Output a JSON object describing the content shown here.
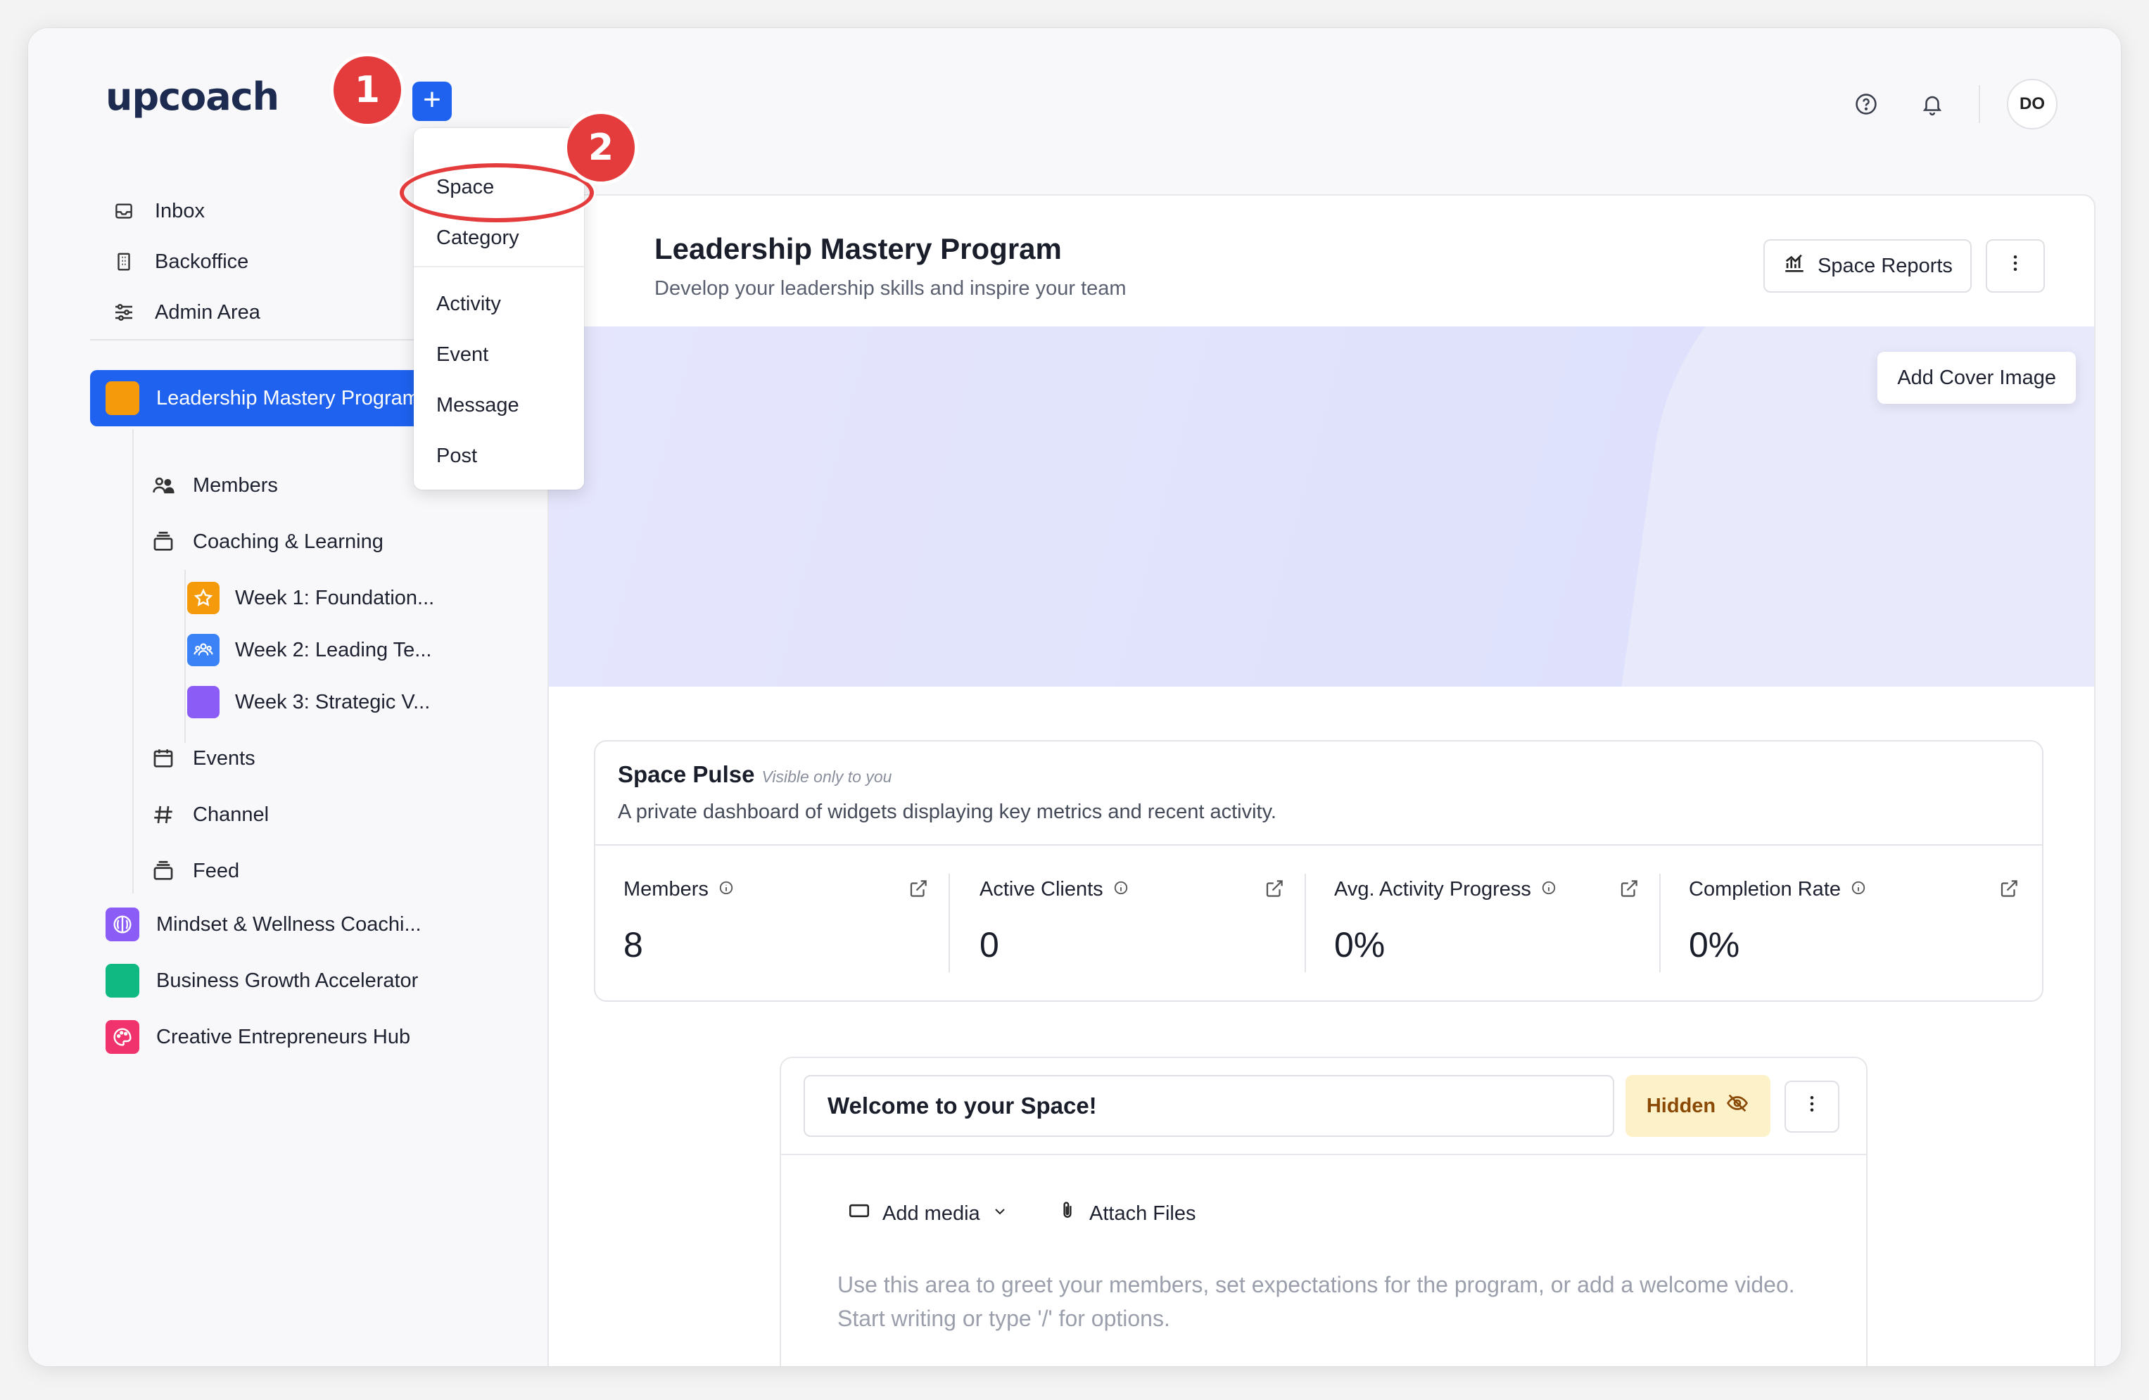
{
  "app": {
    "logo": "upcoach"
  },
  "header": {
    "avatar_initials": "DO",
    "help_icon": "help-circle-icon",
    "bell_icon": "bell-icon"
  },
  "annotations": {
    "step1": "1",
    "step2": "2"
  },
  "create_menu": {
    "items_top": [
      {
        "label": "Space"
      },
      {
        "label": "Category"
      }
    ],
    "items_bottom": [
      {
        "label": "Activity"
      },
      {
        "label": "Event"
      },
      {
        "label": "Message"
      },
      {
        "label": "Post"
      }
    ]
  },
  "sidebar": {
    "nav": [
      {
        "label": "Inbox",
        "icon": "inbox-icon"
      },
      {
        "label": "Backoffice",
        "icon": "building-icon"
      },
      {
        "label": "Admin Area",
        "icon": "sliders-icon"
      }
    ],
    "active_space": {
      "label": "Leadership Mastery Program",
      "color": "#f59a0b"
    },
    "space_children": [
      {
        "label": "Members",
        "icon": "users-icon"
      },
      {
        "label": "Coaching & Learning",
        "icon": "stack-icon"
      },
      {
        "label": "Events",
        "icon": "calendar-icon"
      },
      {
        "label": "Channel",
        "icon": "hash-icon"
      },
      {
        "label": "Feed",
        "icon": "stack-icon"
      }
    ],
    "weeks": [
      {
        "label": "Week 1: Foundation...",
        "color": "#f59a0b",
        "icon": "star-icon"
      },
      {
        "label": "Week 2: Leading Te...",
        "color": "#3b82f6",
        "icon": "people-icon"
      },
      {
        "label": "Week 3: Strategic V...",
        "color": "#8b5cf6",
        "icon": ""
      }
    ],
    "other_spaces": [
      {
        "label": "Mindset & Wellness Coachi...",
        "color": "#8b5cf6",
        "icon": "brain-icon"
      },
      {
        "label": "Business Growth Accelerator",
        "color": "#10b981",
        "icon": ""
      },
      {
        "label": "Creative Entrepreneurs Hub",
        "color": "#f0336c",
        "icon": "palette-icon"
      }
    ]
  },
  "main": {
    "title": "Leadership Mastery Program",
    "subtitle": "Develop your leadership skills and inspire your team",
    "space_reports_label": "Space Reports",
    "add_cover_label": "Add Cover Image",
    "pulse": {
      "title": "Space Pulse",
      "visibility": "Visible only to you",
      "description": "A private dashboard of widgets displaying key metrics and recent activity.",
      "metrics": [
        {
          "label": "Members",
          "value": "8"
        },
        {
          "label": "Active Clients",
          "value": "0"
        },
        {
          "label": "Avg. Activity Progress",
          "value": "0%"
        },
        {
          "label": "Completion Rate",
          "value": "0%"
        }
      ]
    },
    "welcome": {
      "title_value": "Welcome to your Space!",
      "hidden_label": "Hidden",
      "add_media_label": "Add media",
      "attach_label": "Attach Files",
      "placeholder": "Use this area to greet your members, set expectations for the program, or add a welcome video. Start writing or type '/' for options."
    }
  },
  "colors": {
    "primary": "#1f62f0",
    "annotation": "#e43c3c",
    "hidden_bg": "#fdf1c9"
  }
}
